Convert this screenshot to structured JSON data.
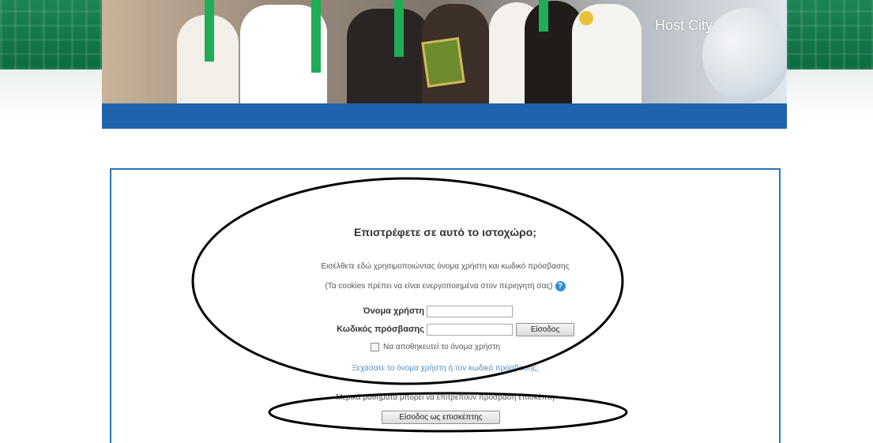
{
  "banner": {
    "text": "Host City"
  },
  "login": {
    "heading": "Επιστρέφετε σε αυτό το ιστοχώρο;",
    "description": "Εισέλθετε εδώ χρησιμοποιώντας όνομα χρήστη και κωδικό πρόσβασης",
    "cookies_note": "(Τα cookies πρέπει να είναι ενεργοποιημένα στον περιηγητή σας)",
    "help_icon_glyph": "?",
    "username_label": "Όνομα χρήστη",
    "username_value": "",
    "password_label": "Κωδικός πρόσβασης",
    "password_value": "",
    "login_button": "Είσοδος",
    "remember_label": "Να αποθηκευτεί το όνομα χρήστη",
    "forgot_link": "Ξεχάσατε το όνομα χρήστη ή τον κωδικό πρόσβασης;",
    "guest_note": "Μερικά μαθήματα μπορεί να επιτρέπουν πρόσβαση επισκέπτη",
    "guest_button": "Είσοδος ως επισκέπτης"
  },
  "colors": {
    "nav_blue": "#1e63ab",
    "box_border": "#2b74b8",
    "side_green": "#137a4b",
    "link": "#4a8fc7"
  }
}
